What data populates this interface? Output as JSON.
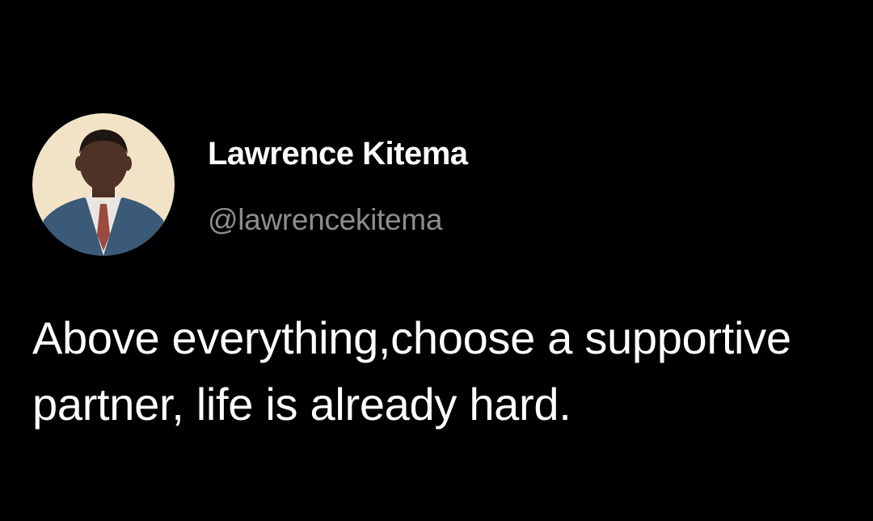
{
  "tweet": {
    "author": {
      "display_name": "Lawrence Kitema",
      "handle": "@lawrencekitema",
      "avatar_icon": "profile-photo"
    },
    "text": "Above everything,choose a supportive partner, life is already hard."
  },
  "colors": {
    "background": "#000000",
    "primary_text": "#ffffff",
    "secondary_text": "#8b8d91"
  }
}
